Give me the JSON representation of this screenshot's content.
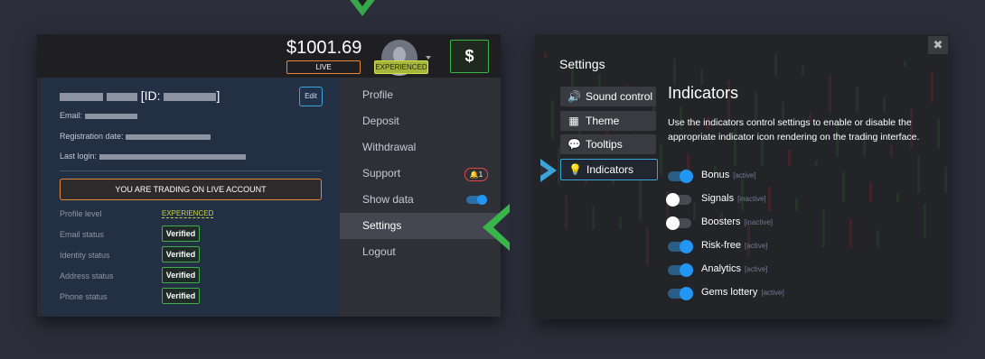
{
  "account": {
    "balance": "$1001.69",
    "mode_badge": "LIVE",
    "level_badge": "EXPERIENCED",
    "deposit_icon": "$"
  },
  "profile": {
    "id_prefix": "[ID:",
    "id_suffix": "]",
    "edit_label": "Edit",
    "email_label": "Email:",
    "registration_label": "Registration date:",
    "last_login_label": "Last login:",
    "live_banner": "YOU ARE TRADING ON LIVE ACCOUNT",
    "stats": [
      {
        "label": "Profile level",
        "value": "EXPERIENCED"
      },
      {
        "label": "Email status",
        "value": "Verified"
      },
      {
        "label": "Identity status",
        "value": "Verified"
      },
      {
        "label": "Address status",
        "value": "Verified"
      },
      {
        "label": "Phone status",
        "value": "Verified"
      }
    ]
  },
  "menu": {
    "items": [
      {
        "label": "Profile"
      },
      {
        "label": "Deposit"
      },
      {
        "label": "Withdrawal"
      },
      {
        "label": "Support",
        "badge": "1"
      },
      {
        "label": "Show data",
        "toggle": "on"
      },
      {
        "label": "Settings",
        "active": true
      },
      {
        "label": "Logout"
      }
    ]
  },
  "settings": {
    "title": "Settings",
    "close_icon": "✖",
    "tabs": [
      {
        "label": "Sound control",
        "icon": "speaker-icon"
      },
      {
        "label": "Theme",
        "icon": "grid-icon"
      },
      {
        "label": "Tooltips",
        "icon": "tooltip-icon"
      },
      {
        "label": "Indicators",
        "icon": "bulb-icon",
        "active": true
      }
    ],
    "indicators": {
      "title": "Indicators",
      "description": "Use the indicators control settings to enable or disable the appropriate indicator icon rendering on the trading interface.",
      "items": [
        {
          "name": "Bonus",
          "status": "[active]",
          "on": true
        },
        {
          "name": "Signals",
          "status": "[inactive]",
          "on": false
        },
        {
          "name": "Boosters",
          "status": "[inactive]",
          "on": false
        },
        {
          "name": "Risk-free",
          "status": "[active]",
          "on": true
        },
        {
          "name": "Analytics",
          "status": "[active]",
          "on": true
        },
        {
          "name": "Gems lottery",
          "status": "[active]",
          "on": true
        }
      ]
    }
  },
  "colors": {
    "background": "#2b2d3a",
    "accent_green": "#39b54a",
    "accent_blue": "#3da3d8",
    "toggle_blue": "#2196f3",
    "live_orange": "#e2873a",
    "experienced_yellow": "#a7b53a"
  }
}
